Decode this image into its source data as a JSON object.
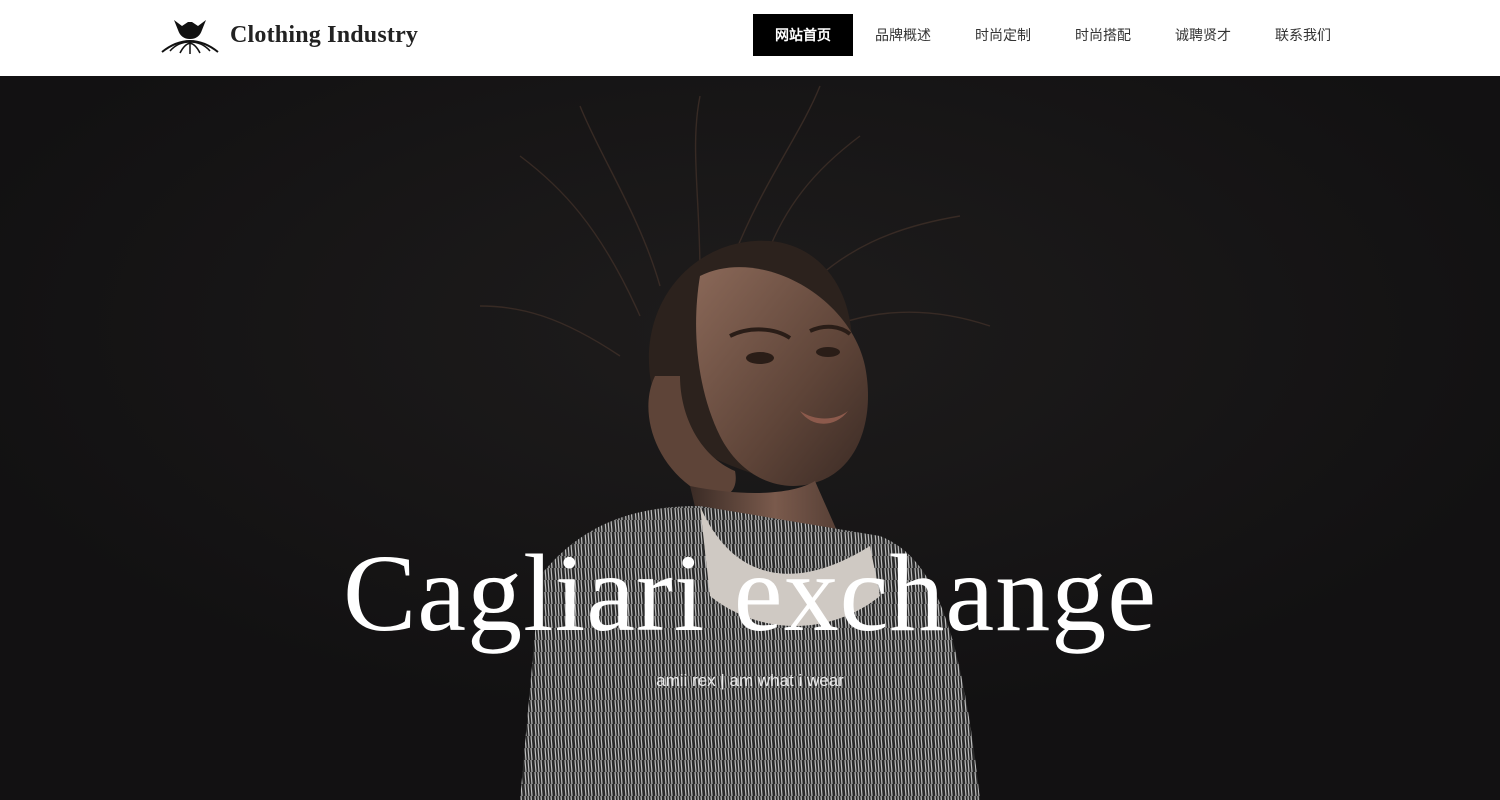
{
  "brand": {
    "name": "Clothing Industry",
    "logo_icon": "fashion-logo-icon"
  },
  "nav": {
    "items": [
      {
        "label": "网站首页",
        "active": true
      },
      {
        "label": "品牌概述",
        "active": false
      },
      {
        "label": "时尚定制",
        "active": false
      },
      {
        "label": "时尚搭配",
        "active": false
      },
      {
        "label": "诚聘贤才",
        "active": false
      },
      {
        "label": "联系我们",
        "active": false
      }
    ]
  },
  "hero": {
    "title": "Cagliari exchange",
    "subtitle": "amii rex | am what i wear"
  },
  "colors": {
    "header_bg": "#ffffff",
    "nav_active_bg": "#000000",
    "nav_active_text": "#ffffff",
    "nav_text": "#333333",
    "hero_bg": "#131213",
    "hero_text": "#ffffff"
  }
}
